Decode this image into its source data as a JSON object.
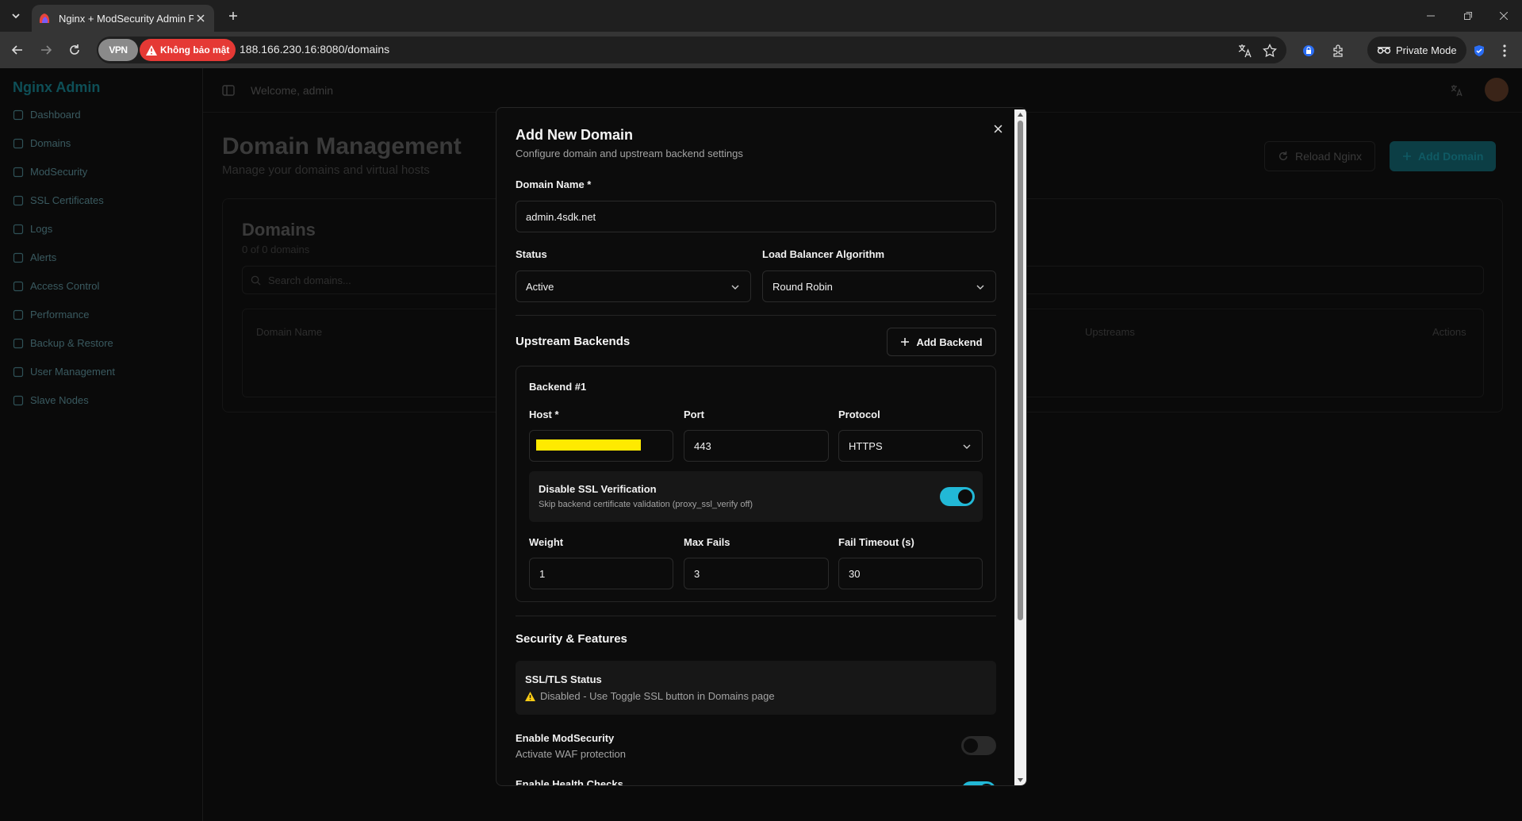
{
  "browser": {
    "tab_title": "Nginx + ModSecurity Admin Pa",
    "vpn_label": "VPN",
    "security_label": "Không bảo mật",
    "url": "188.166.230.16:8080/domains",
    "private_mode_label": "Private Mode"
  },
  "app": {
    "brand": "Nginx Admin",
    "sidebar": [
      {
        "label": "Dashboard",
        "icon": "grid-icon"
      },
      {
        "label": "Domains",
        "icon": "globe-icon"
      },
      {
        "label": "ModSecurity",
        "icon": "shield-icon"
      },
      {
        "label": "SSL Certificates",
        "icon": "lock-icon"
      },
      {
        "label": "Logs",
        "icon": "file-icon"
      },
      {
        "label": "Alerts",
        "icon": "bell-icon"
      },
      {
        "label": "Access Control",
        "icon": "users-icon"
      },
      {
        "label": "Performance",
        "icon": "activity-icon"
      },
      {
        "label": "Backup & Restore",
        "icon": "database-icon"
      },
      {
        "label": "User Management",
        "icon": "user-icon"
      },
      {
        "label": "Slave Nodes",
        "icon": "server-icon"
      }
    ],
    "welcome": "Welcome, admin",
    "page_title": "Domain Management",
    "page_subtitle": "Manage your domains and virtual hosts",
    "reload_button": "Reload Nginx",
    "add_domain_button": "Add Domain",
    "card_title": "Domains",
    "card_subtitle": "0 of 0 domains",
    "search_placeholder": "Search domains...",
    "table_headers": {
      "domain_name": "Domain Name",
      "upstreams": "Upstreams",
      "actions": "Actions"
    }
  },
  "modal": {
    "title": "Add New Domain",
    "description": "Configure domain and upstream backend settings",
    "domain_name_label": "Domain Name *",
    "domain_name_value": "admin.4sdk.net",
    "status_label": "Status",
    "status_value": "Active",
    "lb_label": "Load Balancer Algorithm",
    "lb_value": "Round Robin",
    "upstream_title": "Upstream Backends",
    "add_backend_label": "Add Backend",
    "backend": {
      "title": "Backend #1",
      "host_label": "Host *",
      "port_label": "Port",
      "port_value": "443",
      "protocol_label": "Protocol",
      "protocol_value": "HTTPS",
      "ssl_verify_title": "Disable SSL Verification",
      "ssl_verify_desc": "Skip backend certificate validation (proxy_ssl_verify off)",
      "ssl_verify_on": true,
      "weight_label": "Weight",
      "weight_value": "1",
      "max_fails_label": "Max Fails",
      "max_fails_value": "3",
      "fail_timeout_label": "Fail Timeout (s)",
      "fail_timeout_value": "30"
    },
    "security_title": "Security & Features",
    "ssl_status_title": "SSL/TLS Status",
    "ssl_status_text": "Disabled - Use Toggle SSL button in Domains page",
    "modsecurity_title": "Enable ModSecurity",
    "modsecurity_desc": "Activate WAF protection",
    "modsecurity_on": false,
    "health_checks_title": "Enable Health Checks",
    "health_checks_on": true
  },
  "colors": {
    "accent": "#22b8d6",
    "warning": "#facc15",
    "danger": "#e53935"
  }
}
